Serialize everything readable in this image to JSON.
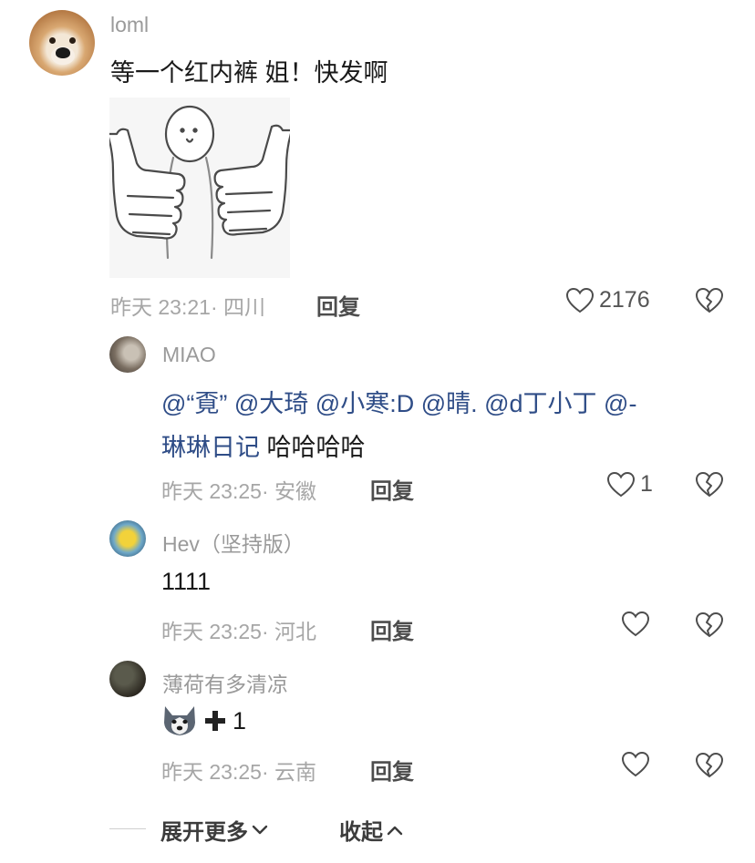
{
  "comments": [
    {
      "username": "loml",
      "text": "等一个红内裤 姐！快发啊",
      "time_location": "昨天 23:21· 四川",
      "reply_label": "回复",
      "likes": "2176"
    },
    {
      "username": "MIAO",
      "mentions_line1": "@“覔” @大琦 @小寒:D @晴.   @d丁小丁 @-",
      "mention_line2": "琳琳日记",
      "text_tail": " 哈哈哈哈",
      "time_location": "昨天 23:25· 安徽",
      "reply_label": "回复",
      "likes": "1"
    },
    {
      "username": "Hev（坚持版）",
      "text": "1111",
      "time_location": "昨天 23:25· 河北",
      "reply_label": "回复",
      "likes": ""
    },
    {
      "username": "薄荷有多清凉",
      "text_suffix": "1",
      "time_location": "昨天 23:25· 云南",
      "reply_label": "回复",
      "likes": ""
    }
  ],
  "footer": {
    "expand_label": "展开更多",
    "collapse_label": "收起"
  },
  "icons": {
    "like": "heart-outline-icon",
    "dislike": "broken-heart-icon",
    "expand": "chevron-down-icon",
    "collapse": "chevron-up-icon",
    "plus": "heavy-plus-icon",
    "emoji": "husky-dog-emoji"
  },
  "colors": {
    "mention": "#2f4d87",
    "meta": "#a6a6a6",
    "username": "#9a9a9a"
  }
}
